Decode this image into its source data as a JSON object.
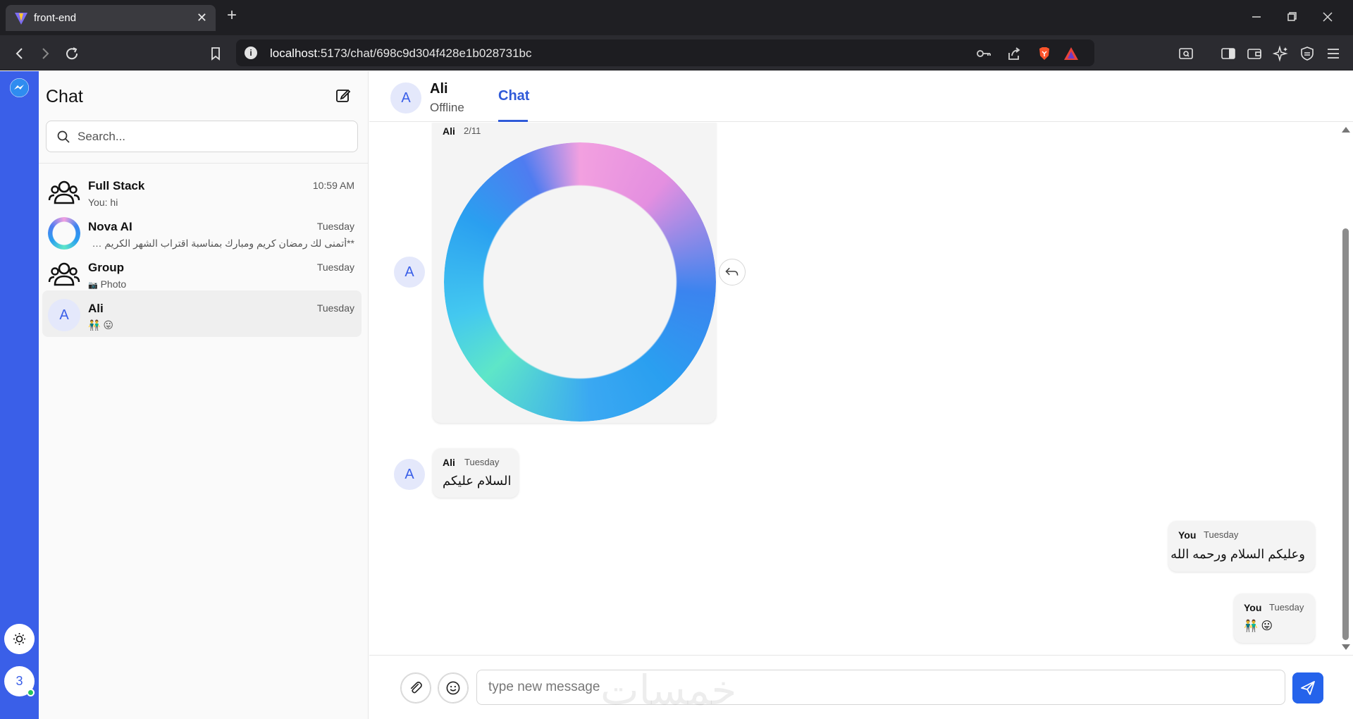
{
  "browser": {
    "tab_title": "front-end",
    "tab_close": "✕",
    "new_tab": "+",
    "url_host": "localhost",
    "url_path": ":5173/chat/698c9d304f428e1b028731bc",
    "url_info": "i"
  },
  "rail": {
    "user_avatar": "3"
  },
  "sidebar": {
    "title": "Chat",
    "search_placeholder": "Search...",
    "conversations": [
      {
        "name": "Full Stack",
        "time": "10:59 AM",
        "preview": "You: hi",
        "avatar": "group-icon"
      },
      {
        "name": "Nova AI",
        "time": "Tuesday",
        "preview": "**أتمنى لك رمضان كريم ومبارك بمناسبة اقتراب الشهر الكريم وبالنسبة لسؤالك السابق لبداية الشهر الهجري.",
        "avatar": "ring-logo-icon"
      },
      {
        "name": "Group",
        "time": "Tuesday",
        "preview_icon": "📷",
        "preview": "Photo",
        "avatar": "group-icon"
      },
      {
        "name": "Ali",
        "time": "Tuesday",
        "preview": "👬 😛",
        "avatar": "A",
        "active": true
      }
    ]
  },
  "chat": {
    "contact_name": "Ali",
    "contact_initial": "A",
    "contact_status": "Offline",
    "tab_label": "Chat",
    "messages": [
      {
        "sender": "Ali",
        "time": "2/11",
        "type": "image",
        "avatar": "A"
      },
      {
        "sender": "Ali",
        "time": "Tuesday",
        "text": "السلام عليكم",
        "avatar": "A"
      },
      {
        "sender": "You",
        "time": "Tuesday",
        "text": "وعليكم السلام ورحمه الله"
      },
      {
        "sender": "You",
        "time": "Tuesday",
        "text": "👬 😛"
      }
    ],
    "input_placeholder": "type new message",
    "watermark": "خمسات"
  },
  "colors": {
    "rail": "#3a5fe8",
    "accent": "#2f5ad8",
    "send": "#2563eb",
    "avatar_bg": "#e4e8fb"
  }
}
